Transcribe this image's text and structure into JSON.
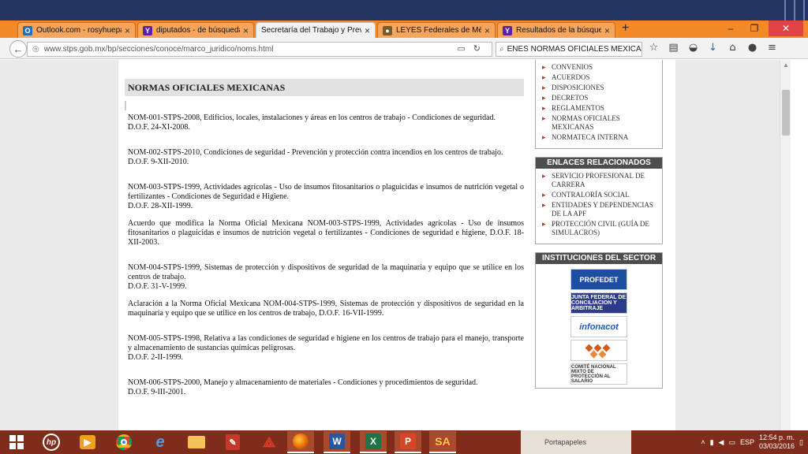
{
  "browser": {
    "tabs": [
      {
        "label": "Outlook.com - rosyhuepa...",
        "icon": "outlook-icon",
        "color": "#1e6fc1",
        "glyph": "O",
        "active": false
      },
      {
        "label": "diputados - de búsqueda",
        "icon": "yahoo-icon",
        "color": "#5b21a8",
        "glyph": "Y",
        "active": false
      },
      {
        "label": "Secretaría del Trabajo y Previsi...",
        "icon": "",
        "color": "",
        "glyph": "",
        "active": true
      },
      {
        "label": "LEYES Federales de México",
        "icon": "globe-icon",
        "color": "#7a5a2a",
        "glyph": "●",
        "active": false
      },
      {
        "label": "Resultados de la búsqued...",
        "icon": "yahoo-icon",
        "color": "#5b21a8",
        "glyph": "Y",
        "active": false
      }
    ],
    "url": "www.stps.gob.mx/bp/secciones/conoce/marco_juridico/noms.html",
    "search_value": "ENES NORMAS OFICIALES MEXICANAS"
  },
  "content": {
    "title": "NORMAS OFICIALES MEXICANAS",
    "norms": [
      {
        "text": "NOM-001-STPS-2008, Edificios, locales, instalaciones y áreas en los centros de trabajo - Condiciones de seguridad.",
        "dof": "D.O.F. 24-XI-2008.",
        "note": ""
      },
      {
        "text": "NOM-002-STPS-2010, Condiciones de seguridad - Prevención y protección contra incendios en los centros de trabajo.",
        "dof": "D.O.F. 9-XII-2010.",
        "note": ""
      },
      {
        "text": "NOM-003-STPS-1999, Actividades agrícolas - Uso de insumos fitosanitarios o plaguicidas e insumos de nutrición vegetal o fertilizantes - Condiciones de Seguridad e Higiene.",
        "dof": "D.O.F. 28-XII-1999.",
        "note": "Acuerdo que modifica la Norma Oficial Mexicana NOM-003-STPS-1999, Actividades agrícolas - Uso de insumos fitosanitarios o plaguicidas e insumos de nutrición vegetal o fertilizantes - Condiciones de seguridad e higiene, D.O.F. 18-XII-2003."
      },
      {
        "text": "NOM-004-STPS-1999, Sistemas de protección y dispositivos de seguridad de la maquinaria y equipo que se utilice en los centros de trabajo.",
        "dof": "D.O.F. 31-V-1999.",
        "note": "Aclaración a la Norma Oficial Mexicana NOM-004-STPS-1999, Sistemas de protección y dispositivos de seguridad en la maquinaria y equipo que se utilice en los centros de trabajo, D.O.F. 16-VII-1999."
      },
      {
        "text": "NOM-005-STPS-1998, Relativa a las condiciones de seguridad e higiene en los centros de trabajo para el manejo, transporte y almacenamiento de sustancias químicas peligrosas.",
        "dof": "D.O.F. 2-II-1999.",
        "note": ""
      },
      {
        "text": "NOM-006-STPS-2000, Manejo y almacenamiento de materiales - Condiciones y procedimientos de seguridad.",
        "dof": "D.O.F. 9-III-2001.",
        "note": ""
      }
    ]
  },
  "sidebar": {
    "marco_items": [
      "CONVENIOS",
      "ACUERDOS",
      "DISPOSICIONES",
      "DECRETOS",
      "REGLAMENTOS",
      "NORMAS OFICIALES MEXICANAS",
      "NORMATECA INTERNA"
    ],
    "enlaces_title": "ENLACES RELACIONADOS",
    "enlaces_items": [
      "SERVICIO PROFESIONAL DE CARRERA",
      "CONTRALORÍA SOCIAL",
      "ENTIDADES Y DEPENDENCIAS DE LA APF",
      "PROTECCIÓN CIVIL (GUÍA DE SIMULACROS)"
    ],
    "instituciones_title": "INSTITUCIONES DEL SECTOR",
    "logos": [
      {
        "name": "profedet-logo",
        "text": "PROFEDET"
      },
      {
        "name": "jfca-logo",
        "text": "JUNTA FEDERAL DE CONCILIACION Y ARBITRAJE"
      },
      {
        "name": "infonacot-logo",
        "text": "infonacot"
      },
      {
        "name": "conasami-logo",
        "text": ""
      },
      {
        "name": "cnmps-logo",
        "text": "COMITÉ NACIONAL MIXTO DE PROTECCIÓN AL SALARIO"
      }
    ]
  },
  "taskbar": {
    "apps": [
      "windows-start-icon",
      "hp-icon",
      "media-player-icon",
      "chrome-icon",
      "ie-icon",
      "file-explorer-icon",
      "app-icon",
      "acrobat-icon",
      "firefox-icon",
      "word-icon",
      "excel-icon",
      "powerpoint-icon",
      "sa-icon"
    ],
    "ghost_label": "Portapapeles",
    "lang": "ESP",
    "time": "12:54 p. m.",
    "date": "03/03/2016"
  }
}
